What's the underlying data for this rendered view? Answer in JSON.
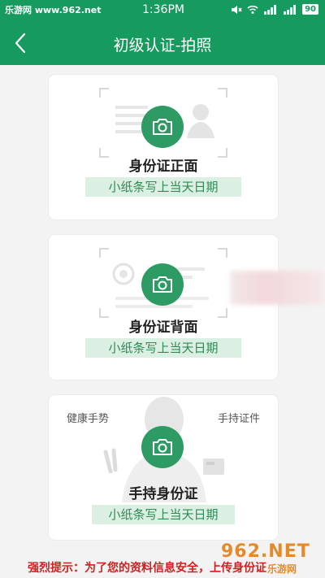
{
  "status_bar": {
    "site": "乐游网 www.962.net",
    "time": "1:36PM",
    "battery": "90"
  },
  "nav": {
    "title": "初级认证-拍照"
  },
  "cards": [
    {
      "label": "身份证正面",
      "note": "小纸条写上当天日期"
    },
    {
      "label": "身份证背面",
      "note": "小纸条写上当天日期"
    },
    {
      "label": "手持身份证",
      "note": "小纸条写上当天日期",
      "left_hint": "健康手势",
      "right_hint": "手持证件"
    }
  ],
  "footer": {
    "warning": "强烈提示：为了您的资料信息安全，上传身份证",
    "watermark": "962.NET",
    "watermark_sub": "乐游网"
  },
  "colors": {
    "primary": "#179a5d",
    "camera": "#2d9b63",
    "note_bg": "#dcefe3",
    "warning": "#d02020"
  }
}
